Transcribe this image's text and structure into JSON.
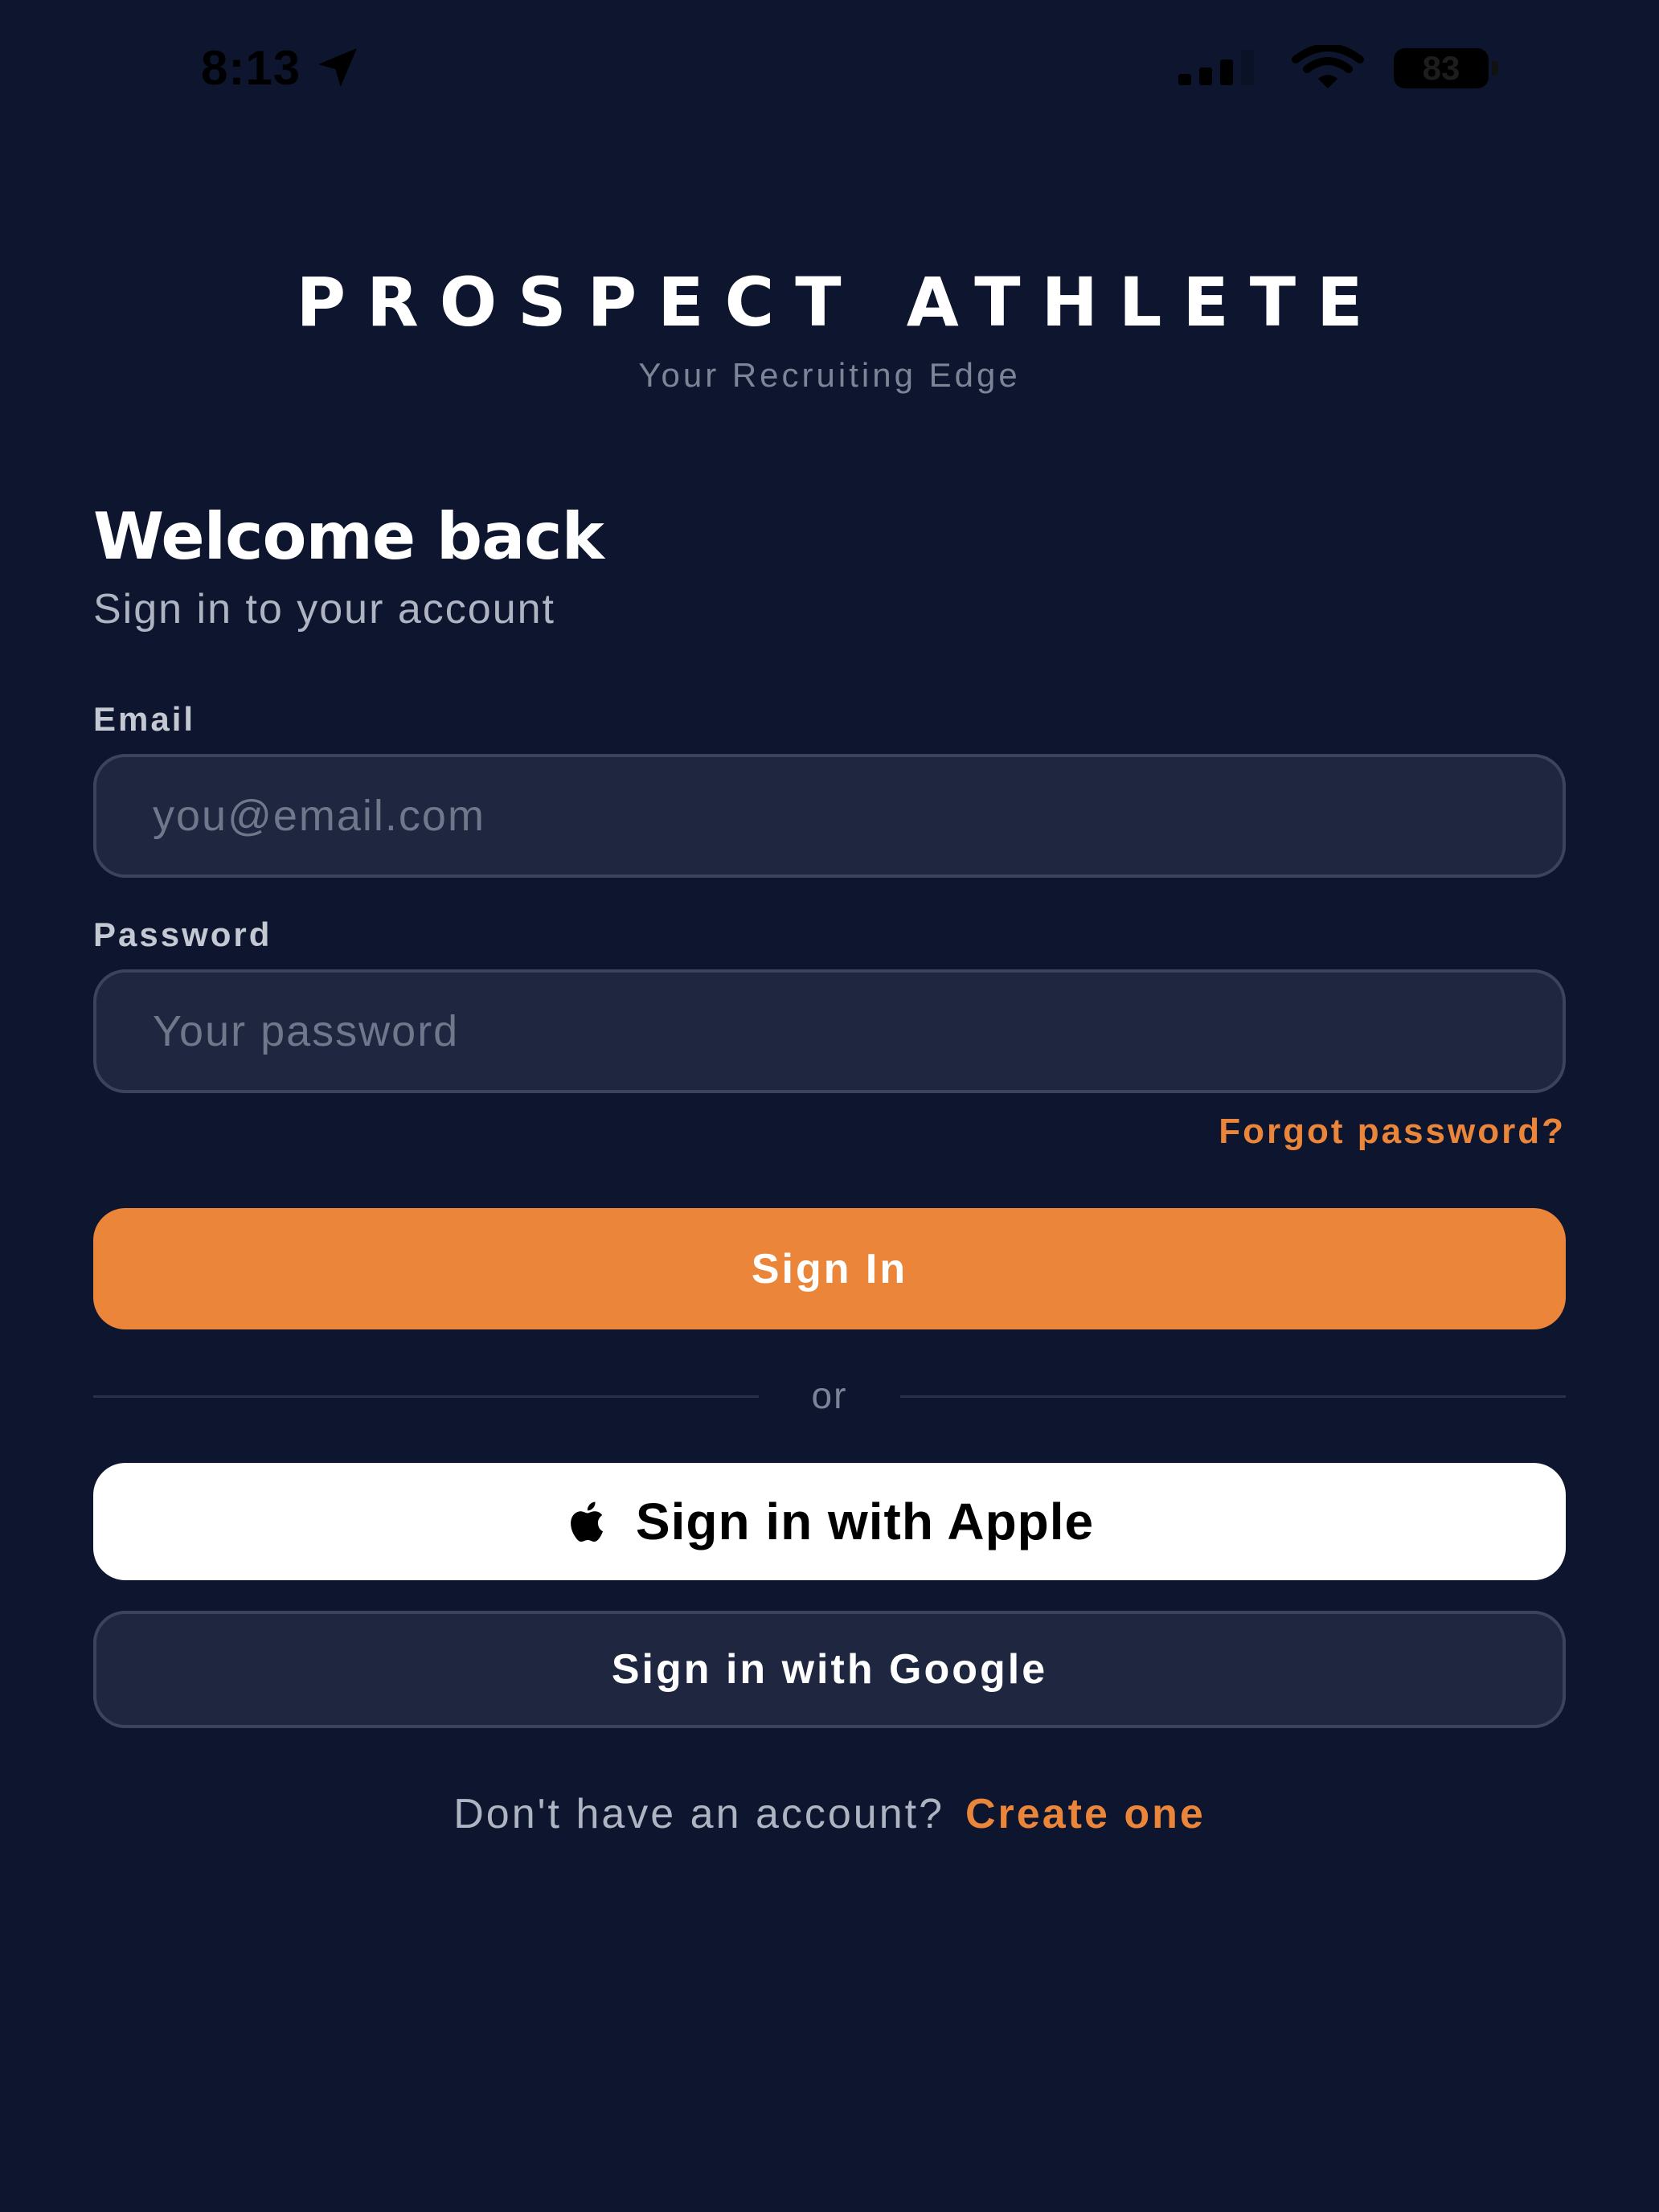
{
  "status_bar": {
    "time": "8:13",
    "battery": "83"
  },
  "brand": {
    "title": "PROSPECT ATHLETE",
    "subtitle": "Your Recruiting Edge"
  },
  "heading": {
    "title": "Welcome back",
    "subtitle": "Sign in to your account"
  },
  "form": {
    "email_label": "Email",
    "email_placeholder": "you@email.com",
    "email_value": "",
    "password_label": "Password",
    "password_placeholder": "Your password",
    "password_value": "",
    "forgot_label": "Forgot password?",
    "signin_label": "Sign In"
  },
  "divider": {
    "label": "or"
  },
  "social": {
    "apple_label": "Sign in with Apple",
    "google_label": "Sign in with Google"
  },
  "footer": {
    "prompt": "Don't have an account?",
    "link_label": "Create one"
  },
  "colors": {
    "background": "#0d162e",
    "accent": "#ea853a",
    "input_background": "#1e2640",
    "input_border": "#3b445c"
  },
  "icons": {
    "location": "location-arrow-icon",
    "signal": "cellular-signal-icon",
    "wifi": "wifi-icon",
    "battery": "battery-icon",
    "apple": "apple-logo-icon"
  }
}
